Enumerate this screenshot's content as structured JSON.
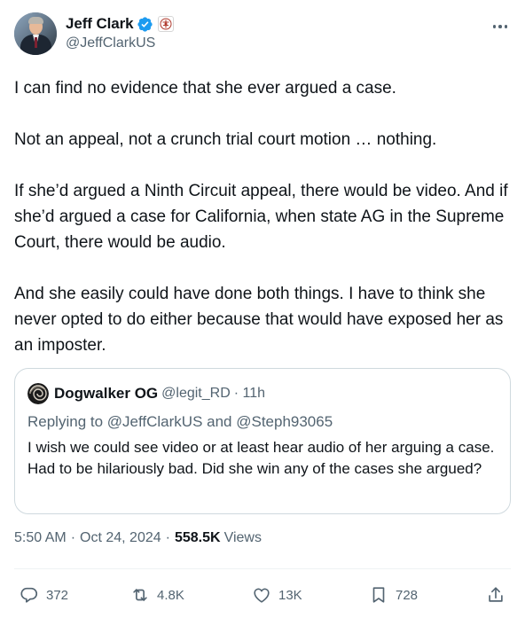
{
  "author": {
    "display_name": "Jeff Clark",
    "handle": "@JeffClarkUS"
  },
  "tweet": {
    "paragraphs": [
      "I can find no evidence that she ever argued a case.",
      "Not an appeal, not a crunch trial court motion … nothing.",
      "If she’d argued a Ninth Circuit appeal, there would be video. And if she’d argued a case for California, when state AG in the Supreme Court, there would be audio.",
      "And she easily could have done both things. I have to think she never opted to do either because that would have exposed her as an imposter."
    ]
  },
  "quote": {
    "display_name": "Dogwalker OG",
    "handle": "@legit_RD",
    "time": "· 11h",
    "replying_to": "Replying to @JeffClarkUS and @Steph93065",
    "text": "I wish we could see video or at least hear audio of her arguing a case. Had to be hilariously bad. Did she win any of the cases she argued?"
  },
  "meta": {
    "time": "5:50 AM",
    "date": "Oct 24, 2024",
    "separator": "·",
    "views_count": "558.5K",
    "views_label": "Views"
  },
  "actions": {
    "replies": "372",
    "reposts": "4.8K",
    "likes": "13K",
    "bookmarks": "728"
  },
  "colors": {
    "text": "#0f1419",
    "secondary": "#536471",
    "verified": "#1d9bf0",
    "border": "#cfd9de"
  },
  "icons": [
    "verified-badge-icon",
    "affiliate-badge-icon",
    "more-icon",
    "reply-icon",
    "repost-icon",
    "like-icon",
    "bookmark-icon",
    "share-icon"
  ]
}
